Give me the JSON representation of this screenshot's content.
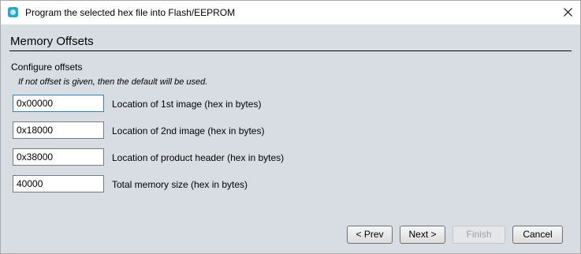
{
  "window": {
    "title": "Program the selected hex file into Flash/EEPROM"
  },
  "page": {
    "section_title": "Memory Offsets",
    "group_label": "Configure offsets",
    "hint": "If not offset is given, then the default will be used."
  },
  "fields": [
    {
      "value": "0x00000",
      "label": "Location of 1st image (hex in bytes)"
    },
    {
      "value": "0x18000",
      "label": "Location of 2nd image (hex in bytes)"
    },
    {
      "value": "0x38000",
      "label": "Location of product header (hex in bytes)"
    },
    {
      "value": "40000",
      "label": "Total memory size (hex in bytes)"
    }
  ],
  "buttons": {
    "prev": "< Prev",
    "next": "Next >",
    "finish": "Finish",
    "cancel": "Cancel"
  },
  "icons": {
    "app": "app-icon",
    "close": "close-icon"
  },
  "colors": {
    "background": "#d8dce3",
    "titlebar": "#ffffff",
    "app_icon": "#28a9c8",
    "focus_border": "#3c7fb1"
  }
}
